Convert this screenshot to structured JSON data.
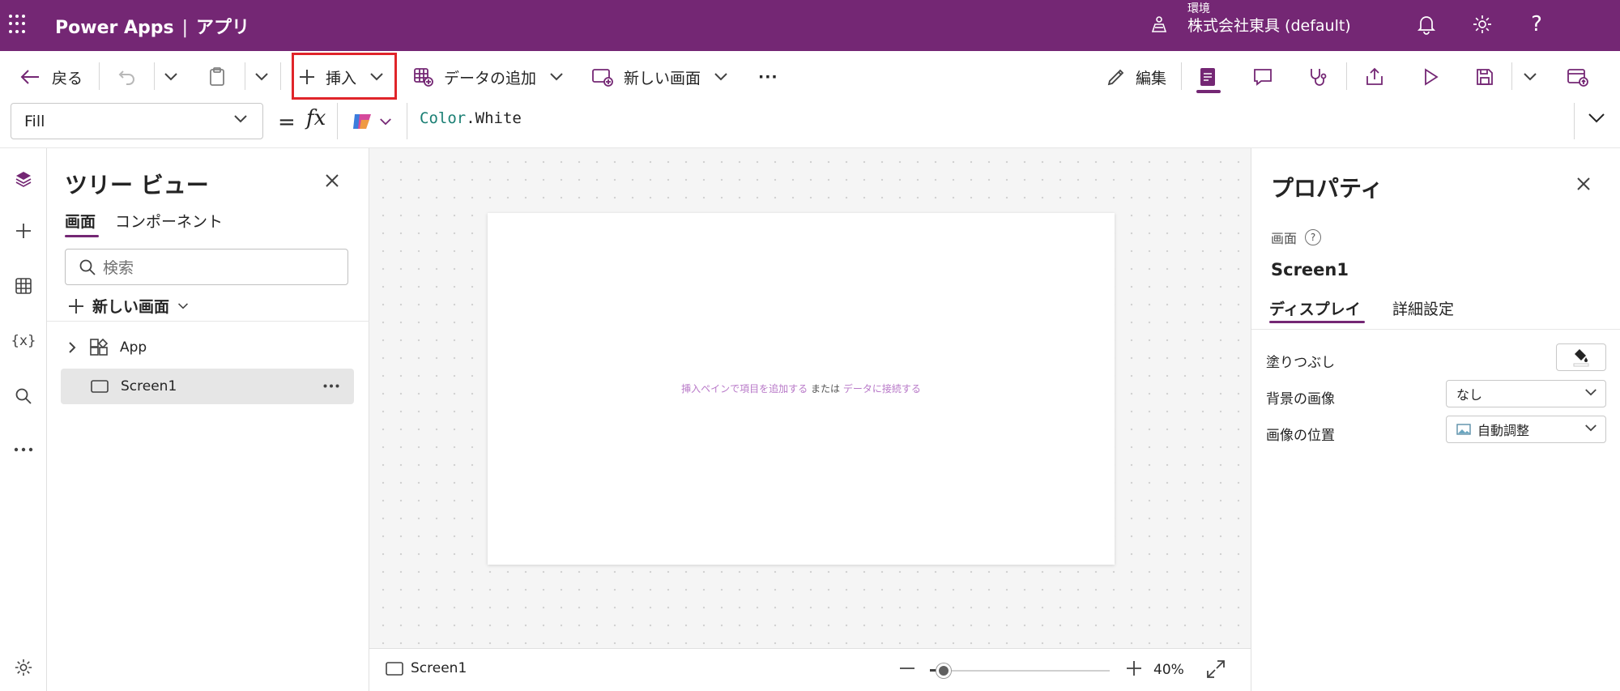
{
  "header": {
    "app_name": "Power Apps",
    "separator": "|",
    "section": "アプリ",
    "environment_label": "環境",
    "environment_name": "株式会社東具 (default)",
    "accent_color": "#742774"
  },
  "toolbar": {
    "back_label": "戻る",
    "insert_label": "挿入",
    "add_data_label": "データの追加",
    "new_screen_label": "新しい画面",
    "more_label": "···",
    "edit_label": "編集"
  },
  "formula_bar": {
    "property": "Fill",
    "equals": "=",
    "fx": "fx",
    "formula_object": "Color",
    "formula_member": ".White"
  },
  "tree_view": {
    "title": "ツリー ビュー",
    "tabs": [
      {
        "label": "画面",
        "active": true
      },
      {
        "label": "コンポーネント",
        "active": false
      }
    ],
    "search_placeholder": "検索",
    "new_screen_label": "新しい画面",
    "nodes": [
      {
        "label": "App",
        "icon": "app-icon",
        "selected": false
      },
      {
        "label": "Screen1",
        "icon": "screen-icon",
        "selected": true
      }
    ]
  },
  "canvas": {
    "hint_link1": "挿入ペインで項目を追加する",
    "hint_middle": " または ",
    "hint_link2": "データに接続する",
    "status_screen": "Screen1",
    "zoom_percent": 40,
    "zoom_label": "40%"
  },
  "properties_panel": {
    "title": "プロパティ",
    "kind": "画面",
    "help_glyph": "?",
    "name": "Screen1",
    "tabs": [
      {
        "label": "ディスプレイ",
        "active": true
      },
      {
        "label": "詳細設定",
        "active": false
      }
    ],
    "rows": [
      {
        "label": "塗りつぶし",
        "control": "color-picker"
      },
      {
        "label": "背景の画像",
        "control": "dropdown",
        "value": "なし"
      },
      {
        "label": "画像の位置",
        "control": "dropdown",
        "value": "自動調整"
      }
    ]
  },
  "rail": {
    "items": [
      "tree-view-icon",
      "insert-icon",
      "data-icon",
      "variables-icon",
      "search-icon",
      "more-icon",
      "settings-icon"
    ],
    "variables_glyph": "{x}"
  }
}
